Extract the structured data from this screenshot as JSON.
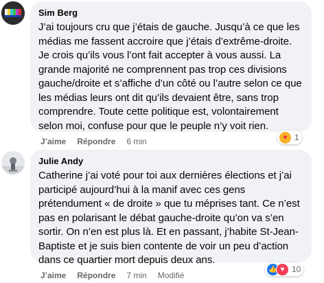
{
  "comments": [
    {
      "author": "Sim Berg",
      "text": "J’ai toujours cru que j’étais de gauche. Jusqu’à ce que les médias me fassent accroire que j’étais d’extrême-droite. Je crois qu’ils vous l’ont fait accepter à vous aussi. La grande majorité ne comprennent pas trop ces divisions gauche/droite et s’affiche d’un côté ou l’autre selon ce que les médias leurs ont dit qu’ils devaient être, sans trop comprendre. Toute cette politique est, volontairement selon moi, confuse pour que le peuple n’y voit rien.",
      "like_label": "J’aime",
      "reply_label": "Répondre",
      "time": "6 min",
      "reaction_count": "1",
      "reaction_icons": [
        "care-emoji-icon"
      ]
    },
    {
      "author": "Julie Andy",
      "text": "Catherine j’ai voté pour toi aux dernières élections et j’ai participé aujourd’hui à la manif avec ces gens prétendument « de droite » que tu méprises tant. Ce n’est pas en polarisant le débat gauche-droite qu’on va s’en sortir. On n’en est plus là. Et en passant, j’habite St-Jean-Baptiste et je suis bien contente de voir un peu d’action dans ce quartier mort depuis deux ans.",
      "like_label": "J’aime",
      "reply_label": "Répondre",
      "time": "7 min",
      "edited_label": "Modifié",
      "reaction_count": "10",
      "reaction_icons": [
        "like-icon",
        "love-icon"
      ]
    }
  ],
  "colors": {
    "bubble": "#f0f2f5",
    "meta_text": "#65676b",
    "like_blue": "#1877f2",
    "love_red": "#f33e58"
  }
}
